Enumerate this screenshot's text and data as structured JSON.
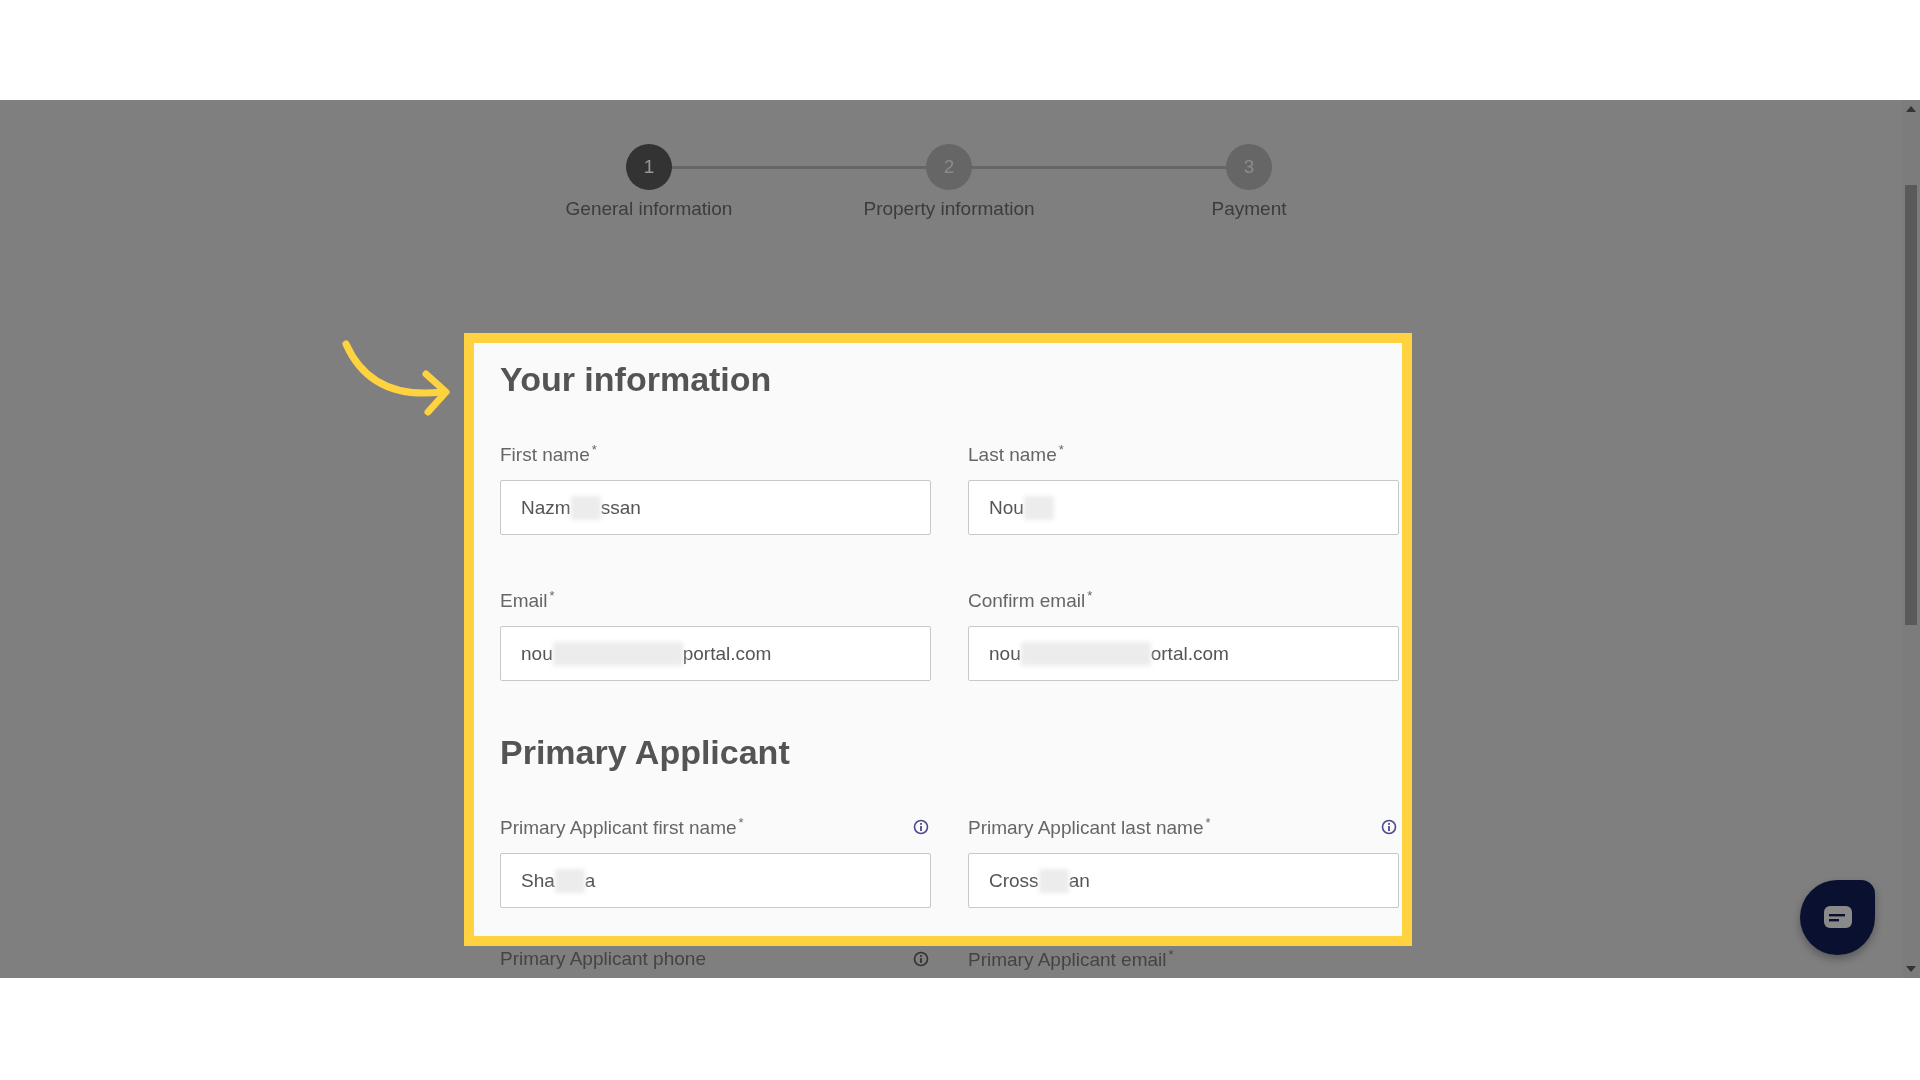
{
  "steps": [
    {
      "number": "1",
      "label": "General information",
      "selected": true
    },
    {
      "number": "2",
      "label": "Property information",
      "selected": false
    },
    {
      "number": "3",
      "label": "Payment",
      "selected": false
    }
  ],
  "sections": [
    {
      "title": "Your information",
      "fields": [
        {
          "label": "First name",
          "asterisk": "*",
          "info": false,
          "kind": "text",
          "redacted": true,
          "value_before": "Nazm",
          "value_after": "ssan"
        },
        {
          "label": "Last name",
          "asterisk": "*",
          "info": false,
          "kind": "text",
          "redacted": true,
          "value_before": "Nou"
        },
        {
          "label": "Email",
          "asterisk": "*",
          "info": false,
          "kind": "email",
          "redacted": true,
          "value_before": "nou",
          "value_after": "portal.com"
        },
        {
          "label": "Confirm email",
          "asterisk": "*",
          "info": false,
          "kind": "email",
          "redacted": true,
          "value_before": "nou",
          "value_after": "ortal.com"
        }
      ]
    },
    {
      "title": "Primary Applicant",
      "fields": [
        {
          "label": "Primary Applicant first name",
          "asterisk": "*",
          "info": true,
          "kind": "text",
          "redacted": true,
          "value_before": "Sha",
          "value_after": "a"
        },
        {
          "label": "Primary Applicant last name",
          "asterisk": "*",
          "info": true,
          "kind": "text",
          "redacted": true,
          "value_before": "Cross",
          "value_after": "an"
        }
      ]
    }
  ],
  "next_fields": [
    {
      "label": "Primary Applicant phone",
      "info": true
    },
    {
      "label": "Primary Applicant email",
      "asterisk": "*",
      "info": false
    }
  ]
}
